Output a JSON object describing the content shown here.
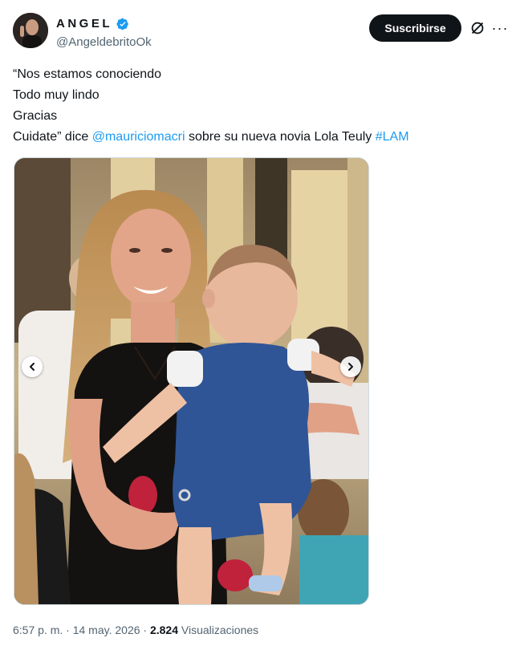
{
  "author": {
    "name": "ANGEL",
    "handle": "@AngeldebritoOk",
    "verified": true
  },
  "actions": {
    "subscribe_label": "Suscribirse",
    "grok_icon": "grok-slash-circle-icon",
    "more_icon": "more-dots-icon"
  },
  "tweet": {
    "line1": "“Nos estamos conociendo",
    "line2": "Todo muy lindo",
    "line3": "Gracias",
    "line4_prefix": "Cuidate” dice ",
    "mention": "@mauriciomacri",
    "line4_middle": " sobre su nueva novia Lola Teuly ",
    "hashtag": "#LAM"
  },
  "media": {
    "prev_icon": "chevron-left-icon",
    "next_icon": "chevron-right-icon"
  },
  "meta": {
    "time": "6:57 p. m.",
    "sep1": " · ",
    "date": "14 may. 2026",
    "sep2": " · ",
    "views_count": "2.824",
    "views_label": " Visualizaciones"
  },
  "colors": {
    "accent": "#1d9bf0",
    "text": "#0f1419",
    "secondary": "#536471",
    "button_bg": "#0f1419"
  }
}
